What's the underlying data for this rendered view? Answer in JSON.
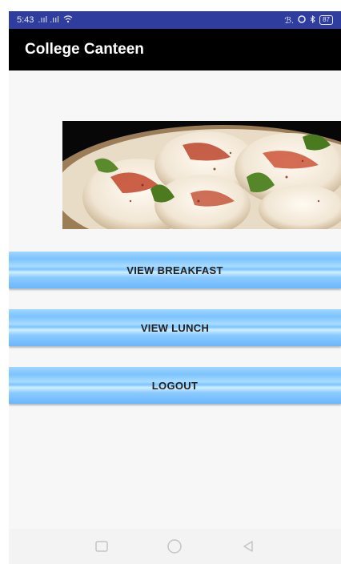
{
  "status_bar": {
    "time": "5:43",
    "signal_text": ".ııl .ııl",
    "left_icons": "wifi-icon",
    "right_text": "ℬ.",
    "battery": "87"
  },
  "toolbar": {
    "title": "College Canteen"
  },
  "main": {
    "image": {
      "subject": "plate of dahi vada topped with chutney and spices",
      "icon": "food-photo"
    },
    "buttons": [
      {
        "label": "VIEW BREAKFAST"
      },
      {
        "label": "VIEW LUNCH"
      },
      {
        "label": "LOGOUT"
      }
    ]
  },
  "nav_bar": {
    "icons": [
      "recent-apps-icon",
      "home-icon",
      "back-icon"
    ]
  },
  "colors": {
    "status_bar": "#2f3e9e",
    "toolbar": "#000000",
    "button_blue": "#7cc3ff",
    "background": "#f7f7f7"
  }
}
